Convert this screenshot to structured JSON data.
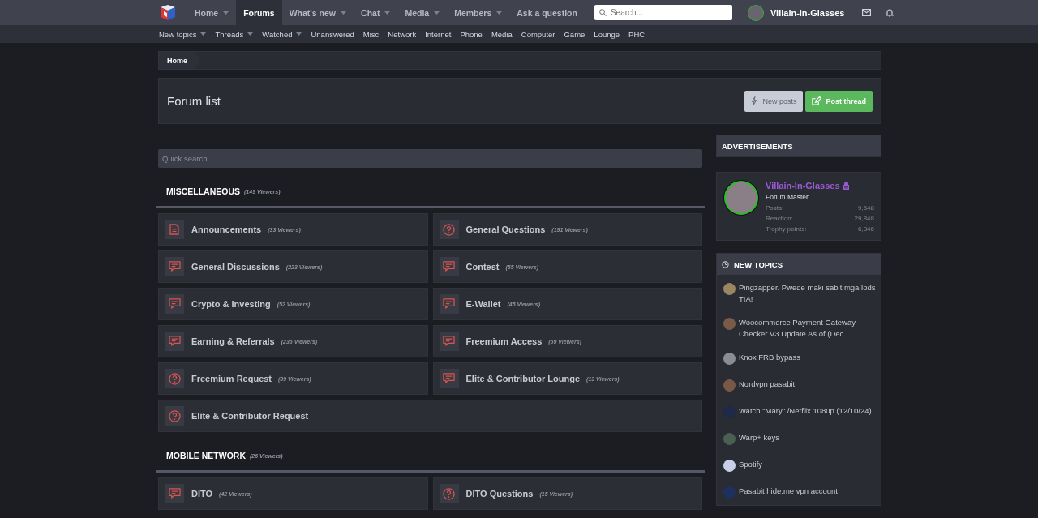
{
  "nav": {
    "items": [
      {
        "label": "Home",
        "selected": false,
        "dropdown": true
      },
      {
        "label": "Forums",
        "selected": true,
        "dropdown": false
      },
      {
        "label": "What's new",
        "selected": false,
        "dropdown": true
      },
      {
        "label": "Chat",
        "selected": false,
        "dropdown": true
      },
      {
        "label": "Media",
        "selected": false,
        "dropdown": true
      },
      {
        "label": "Members",
        "selected": false,
        "dropdown": true
      },
      {
        "label": "Ask a question",
        "selected": false,
        "dropdown": false
      }
    ],
    "search": {
      "placeholder": "Search..."
    },
    "user": {
      "name": "Villain-In-Glasses"
    }
  },
  "subnav": [
    {
      "label": "New topics",
      "dropdown": true
    },
    {
      "label": "Threads",
      "dropdown": true
    },
    {
      "label": "Watched",
      "dropdown": true
    },
    {
      "label": "Unanswered",
      "dropdown": false
    },
    {
      "label": "Misc",
      "dropdown": false
    },
    {
      "label": "Network",
      "dropdown": false
    },
    {
      "label": "Internet",
      "dropdown": false
    },
    {
      "label": "Phone",
      "dropdown": false
    },
    {
      "label": "Media",
      "dropdown": false
    },
    {
      "label": "Computer",
      "dropdown": false
    },
    {
      "label": "Game",
      "dropdown": false
    },
    {
      "label": "Lounge",
      "dropdown": false
    },
    {
      "label": "PHC",
      "dropdown": false
    }
  ],
  "breadcrumb": [
    "Home"
  ],
  "header": {
    "title": "Forum list",
    "buttons": [
      {
        "label": "New posts",
        "kind": "secondary"
      },
      {
        "label": "Post thread",
        "kind": "primary"
      }
    ]
  },
  "quick_search": {
    "placeholder": "Quick search..."
  },
  "categories": [
    {
      "title": "MISCELLANEOUS",
      "viewers": "(149 Viewers)",
      "forums": [
        {
          "title": "Announcements",
          "viewers": "(33 Viewers)",
          "kind": "document"
        },
        {
          "title": "General Questions",
          "viewers": "(191 Viewers)",
          "kind": "question"
        },
        {
          "title": "General Discussions",
          "viewers": "(223 Viewers)",
          "kind": "chat"
        },
        {
          "title": "Contest",
          "viewers": "(55 Viewers)",
          "kind": "chat"
        },
        {
          "title": "Crypto & Investing",
          "viewers": "(52 Viewers)",
          "kind": "chat"
        },
        {
          "title": "E-Wallet",
          "viewers": "(45 Viewers)",
          "kind": "chat"
        },
        {
          "title": "Earning & Referrals",
          "viewers": "(236 Viewers)",
          "kind": "chat"
        },
        {
          "title": "Freemium Access",
          "viewers": "(69 Viewers)",
          "kind": "chat"
        },
        {
          "title": "Freemium Request",
          "viewers": "(39 Viewers)",
          "kind": "question"
        },
        {
          "title": "Elite & Contributor Lounge",
          "viewers": "(13 Viewers)",
          "kind": "chat"
        },
        {
          "title": "Elite & Contributor Request",
          "kind": "question"
        }
      ]
    },
    {
      "title": "MOBILE NETWORK",
      "viewers": "(26 Viewers)",
      "forums": [
        {
          "title": "DITO",
          "viewers": "(42 Viewers)",
          "kind": "chat"
        },
        {
          "title": "DITO Questions",
          "viewers": "(15 Viewers)",
          "kind": "question"
        }
      ]
    }
  ],
  "sidebar": {
    "ads_title": "ADVERTISEMENTS",
    "profile": {
      "name": "Villain-In-Glasses",
      "rank": "Forum Master",
      "stats": [
        {
          "label": "Posts:",
          "value": "9,548"
        },
        {
          "label": "Reaction:",
          "value": "29,848"
        },
        {
          "label": "Trophy points:",
          "value": "6,846"
        }
      ]
    },
    "new_topics": {
      "title": "NEW TOPICS",
      "items": [
        {
          "text": "Pingzapper. Pwede maki sabit mga lods TIA!",
          "color": "#9a8660"
        },
        {
          "text": "Woocommerce Payment Gateway Checker V3 Update As of (Dec...",
          "color": "#7a5a48"
        },
        {
          "text": "Knox FRB bypass",
          "color": "#8a8c96"
        },
        {
          "text": "Nordvpn pasabit",
          "color": "#7a5848"
        },
        {
          "text": "Watch \"Mary\" /Netflix 1080p (12/10/24)",
          "color": "#1e2a48"
        },
        {
          "text": "Warp+ keys",
          "color": "#4a6050"
        },
        {
          "text": "Spotify",
          "color": "#c8d0e8"
        },
        {
          "text": "Pasabit hide.me vpn account",
          "color": "#1e3060"
        }
      ]
    }
  }
}
